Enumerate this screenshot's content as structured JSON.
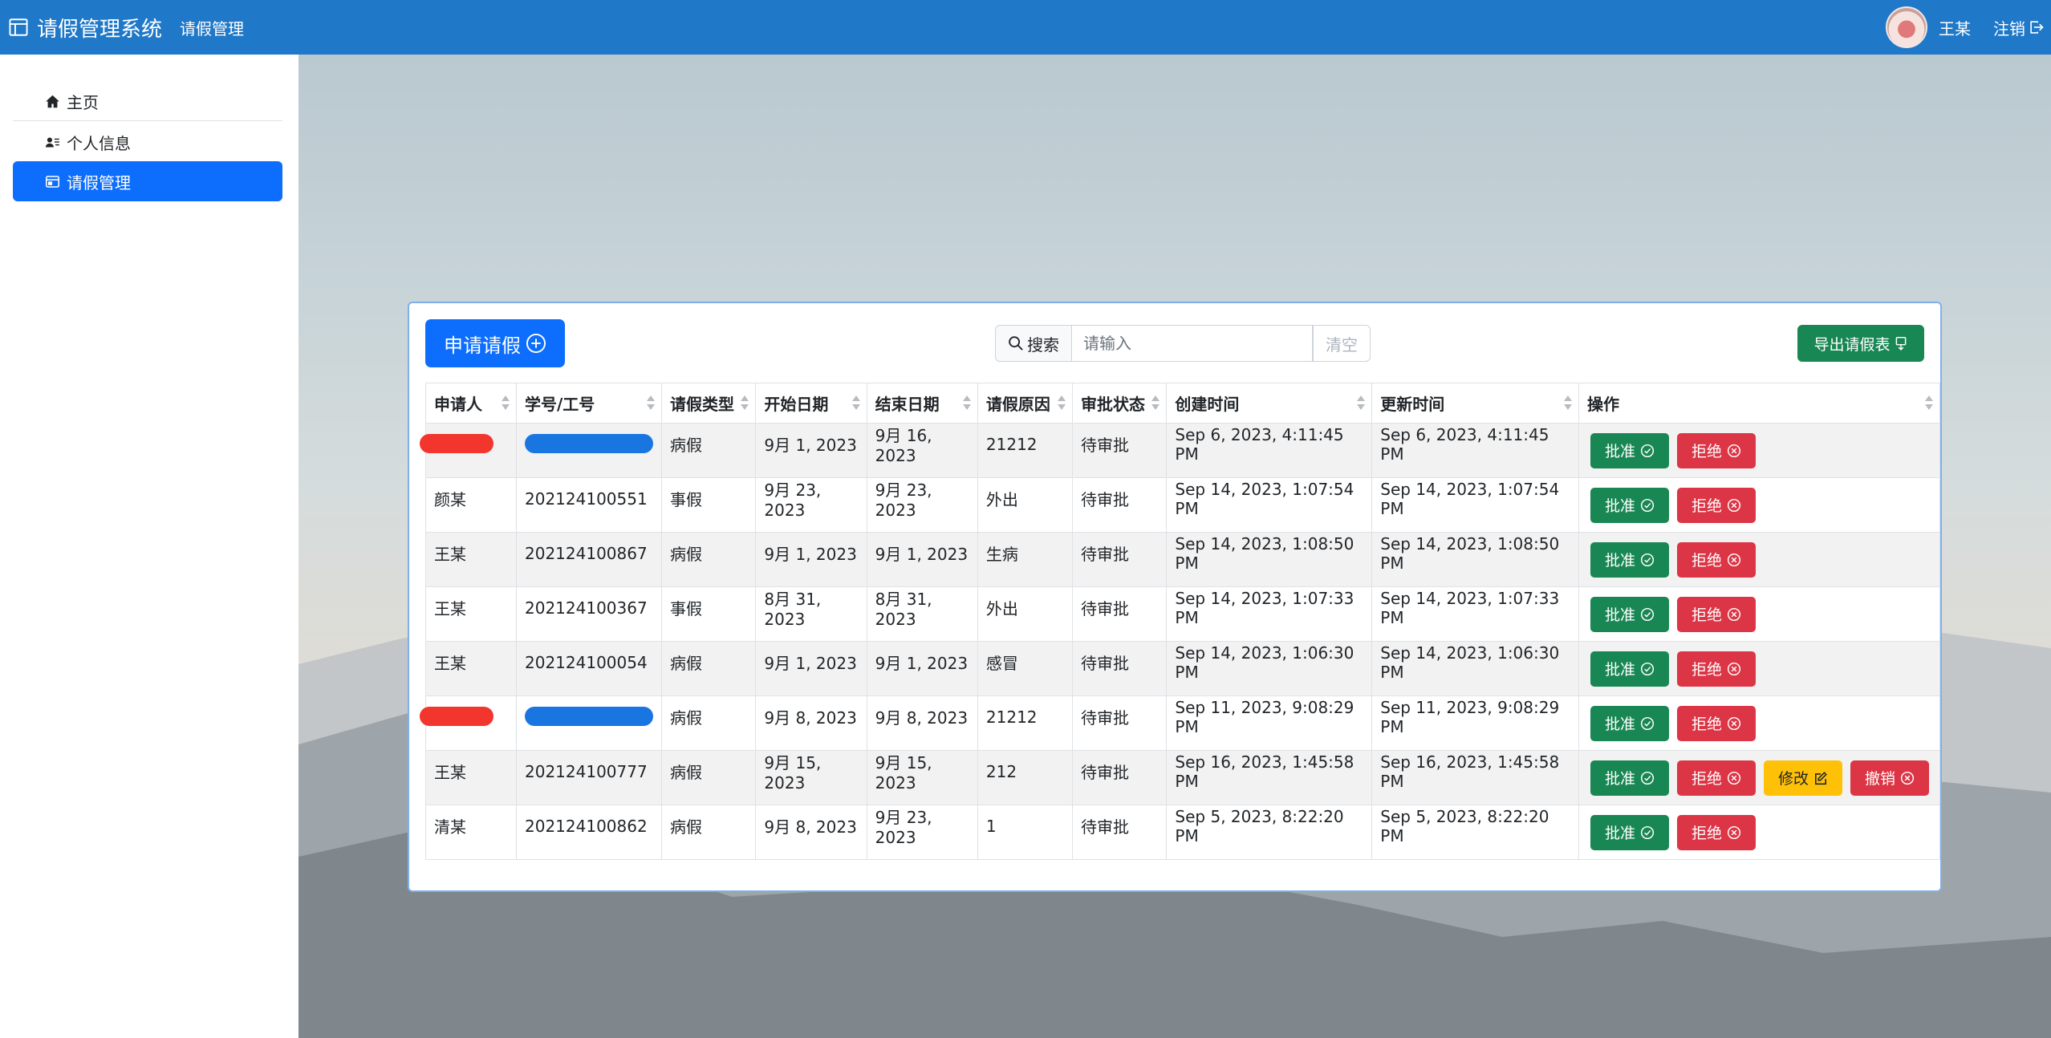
{
  "navbar": {
    "brand": "请假管理系统",
    "nav_link": "请假管理",
    "username": "王某",
    "logout": "注销"
  },
  "sidebar": {
    "items": [
      {
        "label": "主页",
        "icon": "home-icon"
      },
      {
        "label": "个人信息",
        "icon": "person-card-icon"
      },
      {
        "label": "请假管理",
        "icon": "calendar-card-icon",
        "active": true
      }
    ]
  },
  "toolbar": {
    "apply_label": "申请请假",
    "search_label": "搜索",
    "search_placeholder": "请输入",
    "clear_label": "清空",
    "export_label": "导出请假表"
  },
  "table": {
    "columns": [
      "申请人",
      "学号/工号",
      "请假类型",
      "开始日期",
      "结束日期",
      "请假原因",
      "审批状态",
      "创建时间",
      "更新时间",
      "操作"
    ],
    "rows": [
      {
        "name": "",
        "id": "",
        "type": "病假",
        "start": "9月 1, 2023",
        "end": "9月 16, 2023",
        "reason": "21212",
        "status": "待审批",
        "created": "Sep 6, 2023, 4:11:45 PM",
        "updated": "Sep 6, 2023, 4:11:45 PM",
        "redacted": true
      },
      {
        "name": "颜某",
        "id": "202124100551",
        "type": "事假",
        "start": "9月 23, 2023",
        "end": "9月 23, 2023",
        "reason": "外出",
        "status": "待审批",
        "created": "Sep 14, 2023, 1:07:54 PM",
        "updated": "Sep 14, 2023, 1:07:54 PM"
      },
      {
        "name": "王某",
        "id": "202124100867",
        "type": "病假",
        "start": "9月 1, 2023",
        "end": "9月 1, 2023",
        "reason": "生病",
        "status": "待审批",
        "created": "Sep 14, 2023, 1:08:50 PM",
        "updated": "Sep 14, 2023, 1:08:50 PM"
      },
      {
        "name": "王某",
        "id": "202124100367",
        "type": "事假",
        "start": "8月 31, 2023",
        "end": "8月 31, 2023",
        "reason": "外出",
        "status": "待审批",
        "created": "Sep 14, 2023, 1:07:33 PM",
        "updated": "Sep 14, 2023, 1:07:33 PM"
      },
      {
        "name": "王某",
        "id": "202124100054",
        "type": "病假",
        "start": "9月 1, 2023",
        "end": "9月 1, 2023",
        "reason": "感冒",
        "status": "待审批",
        "created": "Sep 14, 2023, 1:06:30 PM",
        "updated": "Sep 14, 2023, 1:06:30 PM"
      },
      {
        "name": "",
        "id": "",
        "type": "病假",
        "start": "9月 8, 2023",
        "end": "9月 8, 2023",
        "reason": "21212",
        "status": "待审批",
        "created": "Sep 11, 2023, 9:08:29 PM",
        "updated": "Sep 11, 2023, 9:08:29 PM",
        "redacted": true
      },
      {
        "name": "王某",
        "id": "202124100777",
        "type": "病假",
        "start": "9月 15, 2023",
        "end": "9月 15, 2023",
        "reason": "212",
        "status": "待审批",
        "created": "Sep 16, 2023, 1:45:58 PM",
        "updated": "Sep 16, 2023, 1:45:58 PM",
        "extra_actions": true
      },
      {
        "name": "清某",
        "id": "202124100862",
        "type": "病假",
        "start": "9月 8, 2023",
        "end": "9月 23, 2023",
        "reason": "1",
        "status": "待审批",
        "created": "Sep 5, 2023, 8:22:20 PM",
        "updated": "Sep 5, 2023, 8:22:20 PM"
      }
    ],
    "actions": {
      "approve": "批准",
      "reject": "拒绝",
      "edit": "修改",
      "cancel": "撤销"
    }
  },
  "colors": {
    "navbar": "#1f78c8",
    "primary": "#0d6efd",
    "success": "#198754",
    "danger": "#dc3545",
    "warning": "#ffc107"
  }
}
